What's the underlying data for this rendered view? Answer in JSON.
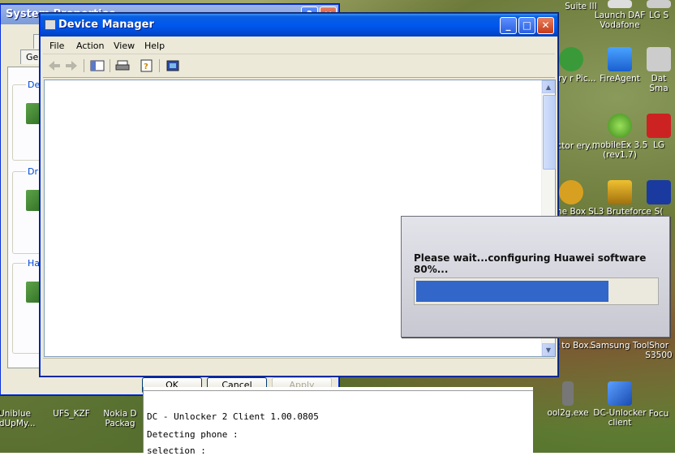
{
  "desktop": {
    "icons": [
      {
        "label": "Suite III"
      },
      {
        "label": "Launch DAF Vodafone"
      },
      {
        "label": "LG S"
      },
      {
        "label": "ttery r Pic..."
      },
      {
        "label": "FireAgent"
      },
      {
        "label": "Dat Sma"
      },
      {
        "label": "Doctor ery..."
      },
      {
        "label": "mobileEx 3.5 (rev1.7)"
      },
      {
        "label": "LG"
      },
      {
        "label": "ne Box"
      },
      {
        "label": "SL3 Bruteforce"
      },
      {
        "label": "S("
      },
      {
        "label": "cut to Box..."
      },
      {
        "label": "Samsung Tool"
      },
      {
        "label": "Shor S3500"
      },
      {
        "label": "ool2g.exe"
      },
      {
        "label": "DC-Unlocker client"
      },
      {
        "label": "Focu"
      },
      {
        "label": "Uniblue edUpMy..."
      },
      {
        "label": "UFS_KZF"
      },
      {
        "label": "Nokia D Packag"
      }
    ]
  },
  "system_properties": {
    "title": "System Properties",
    "tabs": [
      "S",
      "Ge"
    ],
    "groups": [
      {
        "label": "Devi"
      },
      {
        "label": "Drive"
      },
      {
        "label": "Har"
      }
    ],
    "buttons": {
      "ok": "OK",
      "cancel": "Cancel",
      "apply": "Apply"
    }
  },
  "device_manager": {
    "title": "Device Manager",
    "menu": [
      "File",
      "Action",
      "View",
      "Help"
    ],
    "title_buttons": {
      "minimize": "_",
      "maximize": "□",
      "close": "✕"
    }
  },
  "terminal": {
    "lines": [
      "DC - Unlocker 2 Client 1.00.0805",
      "Detecting phone :",
      "selection :"
    ]
  },
  "progress_dialog": {
    "message": "Please wait...configuring Huawei software 80%...",
    "progress": 0.8
  },
  "colors": {
    "xp_blue": "#0058ee",
    "progress_fill": "#3266c8"
  }
}
